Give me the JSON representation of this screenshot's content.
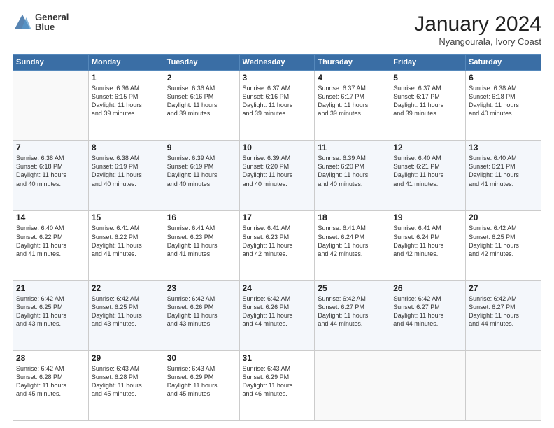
{
  "header": {
    "logo": {
      "line1": "General",
      "line2": "Blue"
    },
    "title": "January 2024",
    "location": "Nyangourala, Ivory Coast"
  },
  "columns": [
    "Sunday",
    "Monday",
    "Tuesday",
    "Wednesday",
    "Thursday",
    "Friday",
    "Saturday"
  ],
  "weeks": [
    [
      {
        "day": "",
        "info": ""
      },
      {
        "day": "1",
        "info": "Sunrise: 6:36 AM\nSunset: 6:15 PM\nDaylight: 11 hours\nand 39 minutes."
      },
      {
        "day": "2",
        "info": "Sunrise: 6:36 AM\nSunset: 6:16 PM\nDaylight: 11 hours\nand 39 minutes."
      },
      {
        "day": "3",
        "info": "Sunrise: 6:37 AM\nSunset: 6:16 PM\nDaylight: 11 hours\nand 39 minutes."
      },
      {
        "day": "4",
        "info": "Sunrise: 6:37 AM\nSunset: 6:17 PM\nDaylight: 11 hours\nand 39 minutes."
      },
      {
        "day": "5",
        "info": "Sunrise: 6:37 AM\nSunset: 6:17 PM\nDaylight: 11 hours\nand 39 minutes."
      },
      {
        "day": "6",
        "info": "Sunrise: 6:38 AM\nSunset: 6:18 PM\nDaylight: 11 hours\nand 40 minutes."
      }
    ],
    [
      {
        "day": "7",
        "info": "Sunrise: 6:38 AM\nSunset: 6:18 PM\nDaylight: 11 hours\nand 40 minutes."
      },
      {
        "day": "8",
        "info": "Sunrise: 6:38 AM\nSunset: 6:19 PM\nDaylight: 11 hours\nand 40 minutes."
      },
      {
        "day": "9",
        "info": "Sunrise: 6:39 AM\nSunset: 6:19 PM\nDaylight: 11 hours\nand 40 minutes."
      },
      {
        "day": "10",
        "info": "Sunrise: 6:39 AM\nSunset: 6:20 PM\nDaylight: 11 hours\nand 40 minutes."
      },
      {
        "day": "11",
        "info": "Sunrise: 6:39 AM\nSunset: 6:20 PM\nDaylight: 11 hours\nand 40 minutes."
      },
      {
        "day": "12",
        "info": "Sunrise: 6:40 AM\nSunset: 6:21 PM\nDaylight: 11 hours\nand 41 minutes."
      },
      {
        "day": "13",
        "info": "Sunrise: 6:40 AM\nSunset: 6:21 PM\nDaylight: 11 hours\nand 41 minutes."
      }
    ],
    [
      {
        "day": "14",
        "info": "Sunrise: 6:40 AM\nSunset: 6:22 PM\nDaylight: 11 hours\nand 41 minutes."
      },
      {
        "day": "15",
        "info": "Sunrise: 6:41 AM\nSunset: 6:22 PM\nDaylight: 11 hours\nand 41 minutes."
      },
      {
        "day": "16",
        "info": "Sunrise: 6:41 AM\nSunset: 6:23 PM\nDaylight: 11 hours\nand 41 minutes."
      },
      {
        "day": "17",
        "info": "Sunrise: 6:41 AM\nSunset: 6:23 PM\nDaylight: 11 hours\nand 42 minutes."
      },
      {
        "day": "18",
        "info": "Sunrise: 6:41 AM\nSunset: 6:24 PM\nDaylight: 11 hours\nand 42 minutes."
      },
      {
        "day": "19",
        "info": "Sunrise: 6:41 AM\nSunset: 6:24 PM\nDaylight: 11 hours\nand 42 minutes."
      },
      {
        "day": "20",
        "info": "Sunrise: 6:42 AM\nSunset: 6:25 PM\nDaylight: 11 hours\nand 42 minutes."
      }
    ],
    [
      {
        "day": "21",
        "info": "Sunrise: 6:42 AM\nSunset: 6:25 PM\nDaylight: 11 hours\nand 43 minutes."
      },
      {
        "day": "22",
        "info": "Sunrise: 6:42 AM\nSunset: 6:25 PM\nDaylight: 11 hours\nand 43 minutes."
      },
      {
        "day": "23",
        "info": "Sunrise: 6:42 AM\nSunset: 6:26 PM\nDaylight: 11 hours\nand 43 minutes."
      },
      {
        "day": "24",
        "info": "Sunrise: 6:42 AM\nSunset: 6:26 PM\nDaylight: 11 hours\nand 44 minutes."
      },
      {
        "day": "25",
        "info": "Sunrise: 6:42 AM\nSunset: 6:27 PM\nDaylight: 11 hours\nand 44 minutes."
      },
      {
        "day": "26",
        "info": "Sunrise: 6:42 AM\nSunset: 6:27 PM\nDaylight: 11 hours\nand 44 minutes."
      },
      {
        "day": "27",
        "info": "Sunrise: 6:42 AM\nSunset: 6:27 PM\nDaylight: 11 hours\nand 44 minutes."
      }
    ],
    [
      {
        "day": "28",
        "info": "Sunrise: 6:42 AM\nSunset: 6:28 PM\nDaylight: 11 hours\nand 45 minutes."
      },
      {
        "day": "29",
        "info": "Sunrise: 6:43 AM\nSunset: 6:28 PM\nDaylight: 11 hours\nand 45 minutes."
      },
      {
        "day": "30",
        "info": "Sunrise: 6:43 AM\nSunset: 6:29 PM\nDaylight: 11 hours\nand 45 minutes."
      },
      {
        "day": "31",
        "info": "Sunrise: 6:43 AM\nSunset: 6:29 PM\nDaylight: 11 hours\nand 46 minutes."
      },
      {
        "day": "",
        "info": ""
      },
      {
        "day": "",
        "info": ""
      },
      {
        "day": "",
        "info": ""
      }
    ]
  ]
}
